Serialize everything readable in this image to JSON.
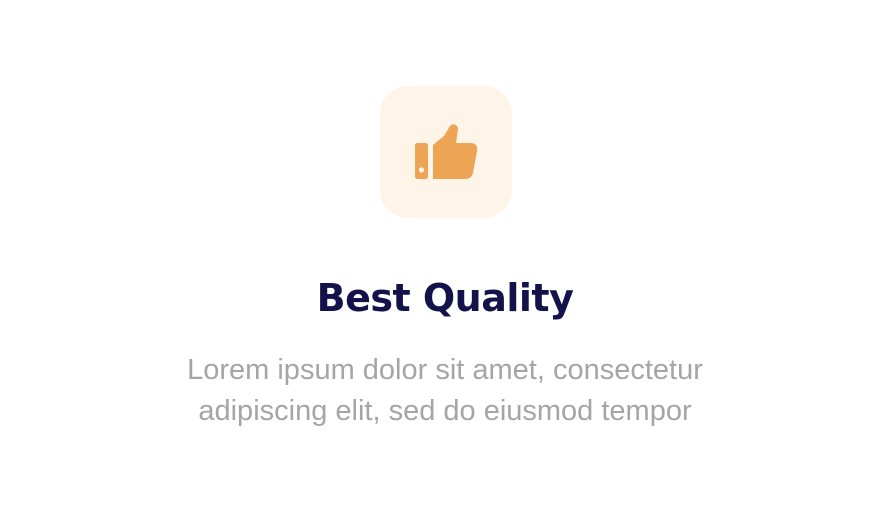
{
  "feature": {
    "icon": "thumbs-up-icon",
    "title": "Best Quality",
    "description_lines": [
      "Lorem ipsum dolor sit amet, consectetur",
      "adipiscing elit, sed do eiusmod tempor"
    ]
  },
  "colors": {
    "icon_background": "#fef4e7",
    "icon": "#eda454",
    "title": "#14124a",
    "description": "#a5a5a5",
    "page_background": "#ffffff"
  }
}
